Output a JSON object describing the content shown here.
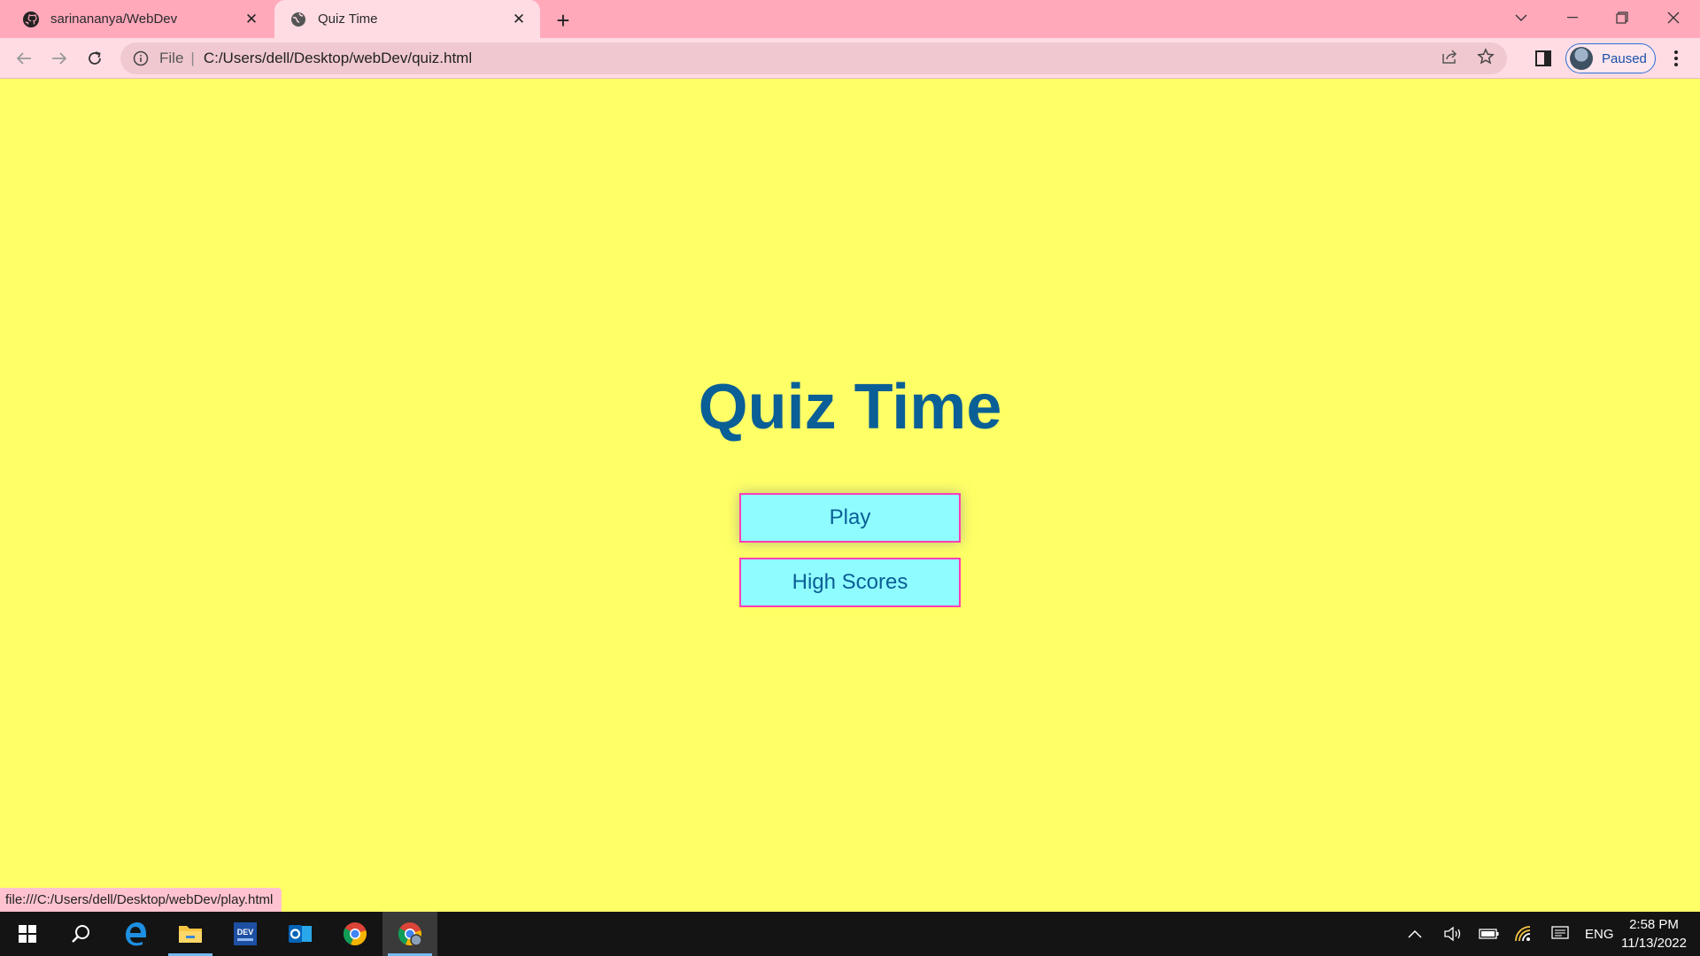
{
  "browser": {
    "tabs": [
      {
        "title": "sarinananya/WebDev",
        "favicon": "github-icon",
        "active": false
      },
      {
        "title": "Quiz Time",
        "favicon": "globe-icon",
        "active": true
      }
    ],
    "address": {
      "scheme_label": "File",
      "url": "C:/Users/dell/Desktop/webDev/quiz.html"
    },
    "profile_label": "Paused",
    "status_url": "file:///C:/Users/dell/Desktop/webDev/play.html"
  },
  "page": {
    "title": "Quiz Time",
    "play_label": "Play",
    "high_scores_label": "High Scores",
    "colors": {
      "background": "#ffff66",
      "title": "#0a5f96",
      "button_fill": "#8ffcff",
      "button_border": "#ff3fb4"
    }
  },
  "taskbar": {
    "language": "ENG",
    "time": "2:58 PM",
    "date": "11/13/2022"
  }
}
